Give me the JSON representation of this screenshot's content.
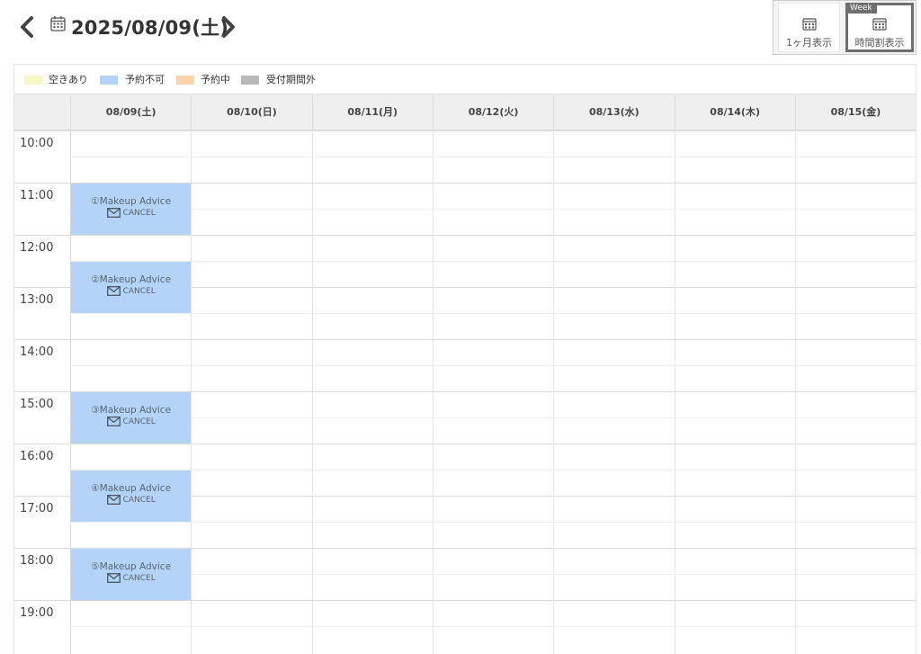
{
  "header": {
    "prev_icon": "chevron-left-icon",
    "next_icon": "chevron-right-icon",
    "date_icon": "calendar-icon",
    "date_title": "2025/08/09(土)"
  },
  "view_switch": {
    "month_label": "1ヶ月表示",
    "week_tag": "Week",
    "week_label": "時間割表示",
    "active": "week"
  },
  "legend": [
    {
      "label": "空きあり",
      "color": "#f8f7c8"
    },
    {
      "label": "予約不可",
      "color": "#b3d4f8"
    },
    {
      "label": "予約中",
      "color": "#fbd4ab"
    },
    {
      "label": "受付期間外",
      "color": "#b8b8b8"
    }
  ],
  "days": [
    "08/09(土)",
    "08/10(日)",
    "08/11(月)",
    "08/12(火)",
    "08/13(水)",
    "08/14(木)",
    "08/15(金)"
  ],
  "times": [
    "10:00",
    "11:00",
    "12:00",
    "13:00",
    "14:00",
    "15:00",
    "16:00",
    "17:00",
    "18:00",
    "19:00"
  ],
  "slots": [
    {
      "title": "①Makeup Advice",
      "cancel": "CANCEL",
      "day": 0,
      "start": "11:00",
      "end": "12:00"
    },
    {
      "title": "②Makeup Advice",
      "cancel": "CANCEL",
      "day": 0,
      "start": "12:30",
      "end": "13:30"
    },
    {
      "title": "③Makeup Advice",
      "cancel": "CANCEL",
      "day": 0,
      "start": "15:00",
      "end": "16:00"
    },
    {
      "title": "④Makeup Advice",
      "cancel": "CANCEL",
      "day": 0,
      "start": "16:30",
      "end": "17:30"
    },
    {
      "title": "⑤Makeup Advice",
      "cancel": "CANCEL",
      "day": 0,
      "start": "18:00",
      "end": "19:00"
    }
  ],
  "colors": {
    "unavailable": "#b3d4f8",
    "header_bg": "#efefef"
  }
}
